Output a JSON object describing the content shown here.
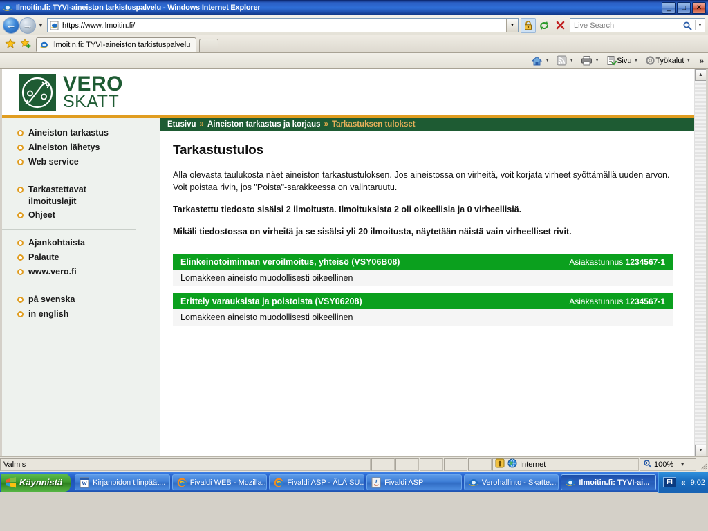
{
  "window": {
    "title": "Ilmoitin.fi: TYVI-aineiston tarkistuspalvelu - Windows Internet Explorer",
    "minimize_label": "_",
    "maximize_label": "□",
    "close_label": "✕"
  },
  "browser": {
    "address_value": "https://www.ilmoitin.fi/",
    "search_placeholder": "Live Search",
    "tab_title": "Ilmoitin.fi: TYVI-aineiston tarkistuspalvelu",
    "commands": {
      "page": "Sivu",
      "tools": "Työkalut",
      "overflow": "»"
    }
  },
  "site": {
    "logo_line1": "VERO",
    "logo_line2": "SKATT",
    "accent_orange": "#e09d20",
    "brand_green": "#1e5b33",
    "result_green": "#0ba01e"
  },
  "sidebar": {
    "groups": [
      {
        "items": [
          {
            "label": "Aineiston tarkastus"
          },
          {
            "label": "Aineiston lähetys"
          },
          {
            "label": "Web service"
          }
        ]
      },
      {
        "items": [
          {
            "label": "Tarkastettavat ilmoituslajit"
          },
          {
            "label": "Ohjeet"
          }
        ]
      },
      {
        "items": [
          {
            "label": "Ajankohtaista"
          },
          {
            "label": "Palaute"
          },
          {
            "label": "www.vero.fi"
          }
        ]
      },
      {
        "items": [
          {
            "label": "på svenska"
          },
          {
            "label": "in english"
          }
        ]
      }
    ]
  },
  "breadcrumb": {
    "home": "Etusivu",
    "sep": "»",
    "section": "Aineiston tarkastus ja korjaus",
    "current": "Tarkastuksen tulokset"
  },
  "main": {
    "heading": "Tarkastustulos",
    "intro": "Alla olevasta taulukosta näet aineiston tarkastustuloksen. Jos aineistossa on virheitä, voit korjata virheet syöttämällä uuden arvon. Voit poistaa rivin, jos \"Poista\"-sarakkeessa on valintaruutu.",
    "summary": "Tarkastettu tiedosto sisälsi 2 ilmoitusta. Ilmoituksista 2 oli oikeellisia ja 0 virheellisiä.",
    "note": "Mikäli tiedostossa on virheitä ja se sisälsi yli 20 ilmoitusta, näytetään näistä vain virheelliset rivit.",
    "customer_label": "Asiakastunnus",
    "results": [
      {
        "form_title": "Elinkeinotoiminnan veroilmoitus, yhteisö (VSY06B08)",
        "customer_id": "1234567-1",
        "status_text": "Lomakkeen aineisto muodollisesti oikeellinen"
      },
      {
        "form_title": "Erittely varauksista ja poistoista (VSY06208)",
        "customer_id": "1234567-1",
        "status_text": "Lomakkeen aineisto muodollisesti oikeellinen"
      }
    ]
  },
  "statusbar": {
    "message": "Valmis",
    "zone": "Internet",
    "zoom": "100%",
    "zoom_caret": "▾"
  },
  "taskbar": {
    "start_label": "Käynnistä",
    "buttons": [
      {
        "label": "Kirjanpidon tilinpäät...",
        "icon": "word-icon",
        "active": false
      },
      {
        "label": "Fivaldi WEB - Mozilla...",
        "icon": "firefox-icon",
        "active": false
      },
      {
        "label": "Fivaldi ASP - ÄLÄ SU...",
        "icon": "firefox-icon",
        "active": false
      },
      {
        "label": "Fivaldi ASP",
        "icon": "java-icon",
        "active": false
      },
      {
        "label": "Verohallinto - Skatte...",
        "icon": "ie-icon",
        "active": false
      },
      {
        "label": "Ilmoitin.fi: TYVI-ai...",
        "icon": "ie-icon",
        "active": true
      }
    ],
    "tray": {
      "language": "FI",
      "chevron": "«",
      "clock": "9:02"
    }
  }
}
